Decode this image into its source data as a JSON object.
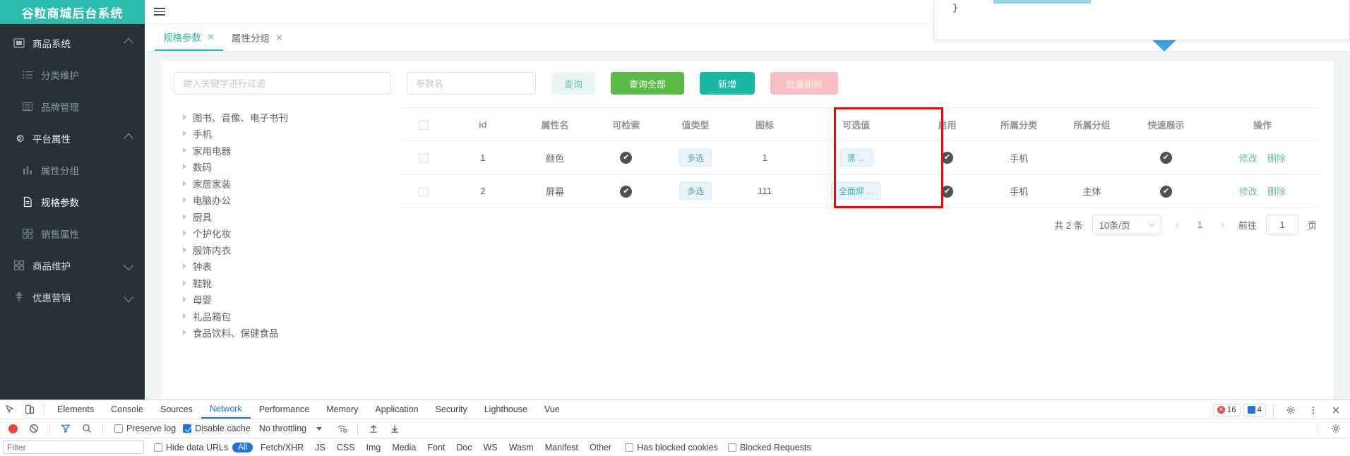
{
  "app": {
    "logo_title": "谷粒商城后台系统"
  },
  "sidebar": {
    "groups": [
      {
        "label": "商品系统",
        "icon": "product-system-icon",
        "caret": "up",
        "items": [
          {
            "label": "分类维护",
            "icon": "list-icon"
          },
          {
            "label": "品牌管理",
            "icon": "brand-icon"
          }
        ]
      },
      {
        "label": "平台属性",
        "icon": "gear-icon",
        "caret": "up",
        "items": [
          {
            "label": "属性分组",
            "icon": "bar-chart-icon"
          },
          {
            "label": "规格参数",
            "icon": "document-icon",
            "active": true
          },
          {
            "label": "销售属性",
            "icon": "grid-icon"
          }
        ]
      },
      {
        "label": "商品维护",
        "icon": "grid-icon",
        "caret": "down",
        "items": []
      },
      {
        "label": "优惠营销",
        "icon": "promo-icon",
        "caret": "down",
        "items": []
      }
    ]
  },
  "topbar": {
    "hamburger_icon": "hamburger-icon"
  },
  "tabs": [
    {
      "label": "规格参数",
      "active": true,
      "close_icon": "close-icon"
    },
    {
      "label": "属性分组",
      "active": false,
      "close_icon": "close-icon"
    }
  ],
  "filters": {
    "keyword_placeholder": "输入关键字进行过滤",
    "keyword_value": "",
    "param_placeholder": "参数名",
    "param_value": "",
    "buttons": {
      "query": "查询",
      "query_all": "查询全部",
      "add": "新增",
      "batch_delete": "批量删除"
    }
  },
  "tree": {
    "nodes": [
      "图书、音像、电子书刊",
      "手机",
      "家用电器",
      "数码",
      "家居家装",
      "电脑办公",
      "厨具",
      "个护化妆",
      "服饰内衣",
      "钟表",
      "鞋靴",
      "母婴",
      "礼品箱包",
      "食品饮料、保健食品"
    ]
  },
  "table": {
    "headers": [
      "",
      "id",
      "属性名",
      "可检索",
      "值类型",
      "图标",
      "可选值",
      "启用",
      "所属分类",
      "所属分组",
      "快速展示",
      "操作"
    ],
    "rows": [
      {
        "checked": false,
        "id": "1",
        "attr_name": "颜色",
        "searchable": "✔",
        "value_type": "多选",
        "icon": "1",
        "enum_value": "黑 ...",
        "enabled": "✔",
        "category": "手机",
        "group": "",
        "quick_show": "✔",
        "actions": [
          "修改",
          "删除"
        ]
      },
      {
        "checked": false,
        "id": "2",
        "attr_name": "屏幕",
        "searchable": "✔",
        "value_type": "多选",
        "icon": "111",
        "enum_value": "全面屏 ...",
        "enabled": "✔",
        "category": "手机",
        "group": "主体",
        "quick_show": "✔",
        "actions": [
          "修改",
          "删除"
        ]
      }
    ]
  },
  "pagination": {
    "total_text": "共 2 条",
    "page_size": "10条/页",
    "prev_icon": "chevron-left-icon",
    "next_icon": "chevron-right-icon",
    "current_page": "1",
    "jump_label": "前往",
    "jump_value": "1",
    "page_unit": "页"
  },
  "code_panel": {
    "text": "}"
  },
  "devtools": {
    "tabs": [
      "Elements",
      "Console",
      "Sources",
      "Network",
      "Performance",
      "Memory",
      "Application",
      "Security",
      "Lighthouse",
      "Vue"
    ],
    "active_tab": "Network",
    "error_count": "16",
    "message_count": "4",
    "toolbar": {
      "preserve_log": "Preserve log",
      "preserve_log_checked": false,
      "disable_cache": "Disable cache",
      "disable_cache_checked": true,
      "throttling": "No throttling"
    },
    "filter_row": {
      "filter_placeholder": "Filter",
      "hide_data_urls": "Hide data URLs",
      "all_pill": "All",
      "types": [
        "Fetch/XHR",
        "JS",
        "CSS",
        "Img",
        "Media",
        "Font",
        "Doc",
        "WS",
        "Wasm",
        "Manifest",
        "Other"
      ],
      "has_blocked_cookies": "Has blocked cookies",
      "blocked_requests": "Blocked Requests"
    },
    "icons": {
      "inspect": "inspect-icon",
      "device": "device-toolbar-icon",
      "record": "record-icon",
      "clear": "clear-icon",
      "filter": "filter-icon",
      "search": "search-icon",
      "wifi": "network-conditions-icon",
      "import": "import-har-icon",
      "export": "export-har-icon",
      "settings": "gear-icon",
      "more": "more-options-icon",
      "close": "close-icon"
    }
  }
}
